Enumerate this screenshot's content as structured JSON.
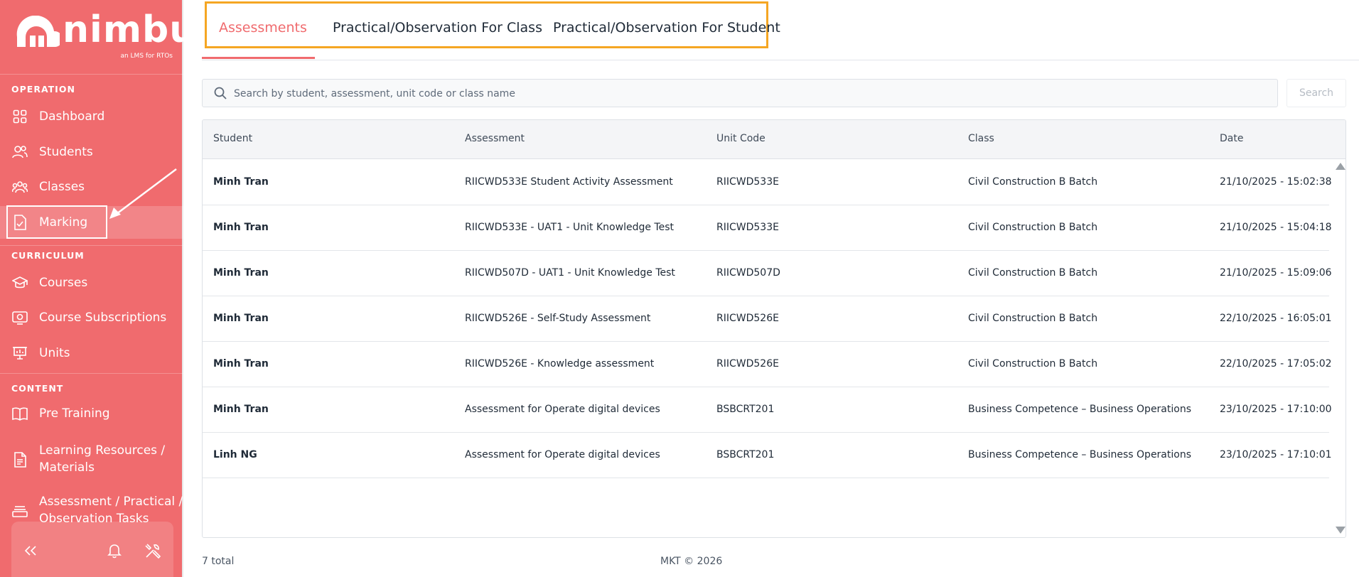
{
  "brand": {
    "name": "nimbu",
    "tagline": "an LMS for RTOs",
    "color": "#f06b6e"
  },
  "sidebar": {
    "sections": [
      {
        "title": "OPERATION"
      },
      {
        "title": "CURRICULUM"
      },
      {
        "title": "CONTENT"
      }
    ],
    "items": [
      {
        "label": "Dashboard",
        "icon": "grid-icon"
      },
      {
        "label": "Students",
        "icon": "users-icon"
      },
      {
        "label": "Classes",
        "icon": "group-icon"
      },
      {
        "label": "Marking",
        "icon": "marking-icon",
        "active": true
      },
      {
        "label": "Courses",
        "icon": "graduation-cap-icon"
      },
      {
        "label": "Course Subscriptions",
        "icon": "subscription-icon"
      },
      {
        "label": "Units",
        "icon": "presentation-icon"
      },
      {
        "label": "Pre Training",
        "icon": "book-icon"
      },
      {
        "label": "Learning Resources / Materials",
        "label_line1": "Learning Resources /",
        "label_line2": "Materials",
        "icon": "document-icon"
      },
      {
        "label": "Assessment / Practical / Observation Tasks",
        "label_line1": "Assessment / Practical /",
        "label_line2": "Observation Tasks",
        "icon": "tray-icon"
      }
    ],
    "bottom_icons": [
      "collapse-icon",
      "bell-icon",
      "tools-icon"
    ]
  },
  "tabs": [
    {
      "label": "Assessments",
      "active": true
    },
    {
      "label": "Practical/Observation For Class"
    },
    {
      "label": "Practical/Observation For Student"
    }
  ],
  "search": {
    "placeholder": "Search by student, assessment, unit code or class name",
    "button_label": "Search"
  },
  "table": {
    "columns": [
      "Student",
      "Assessment",
      "Unit Code",
      "Class",
      "Date"
    ],
    "rows": [
      [
        "Minh Tran",
        "RIICWD533E Student Activity Assessment",
        "RIICWD533E",
        "Civil Construction B Batch",
        "21/10/2025 - 15:02:38"
      ],
      [
        "Minh Tran",
        "RIICWD533E - UAT1 - Unit Knowledge Test",
        "RIICWD533E",
        "Civil Construction B Batch",
        "21/10/2025 - 15:04:18"
      ],
      [
        "Minh Tran",
        "RIICWD507D - UAT1 - Unit Knowledge Test",
        "RIICWD507D",
        "Civil Construction B Batch",
        "21/10/2025 - 15:09:06"
      ],
      [
        "Minh Tran",
        "RIICWD526E - Self-Study Assessment",
        "RIICWD526E",
        "Civil Construction B Batch",
        "22/10/2025 - 16:05:01"
      ],
      [
        "Minh Tran",
        "RIICWD526E - Knowledge assessment",
        "RIICWD526E",
        "Civil Construction B Batch",
        "22/10/2025 - 17:05:02"
      ],
      [
        "Minh Tran",
        "Assessment for Operate digital devices",
        "BSBCRT201",
        "Business Competence – Business Operations",
        "23/10/2025 - 17:10:00"
      ],
      [
        "Linh NG",
        "Assessment for Operate digital devices",
        "BSBCRT201",
        "Business Competence – Business Operations",
        "23/10/2025 - 17:10:01"
      ]
    ]
  },
  "footer": {
    "total": "7 total",
    "copyright": "MKT © 2026"
  },
  "colors": {
    "highlight_orange": "#f5a623",
    "accent": "#f06b6e"
  }
}
